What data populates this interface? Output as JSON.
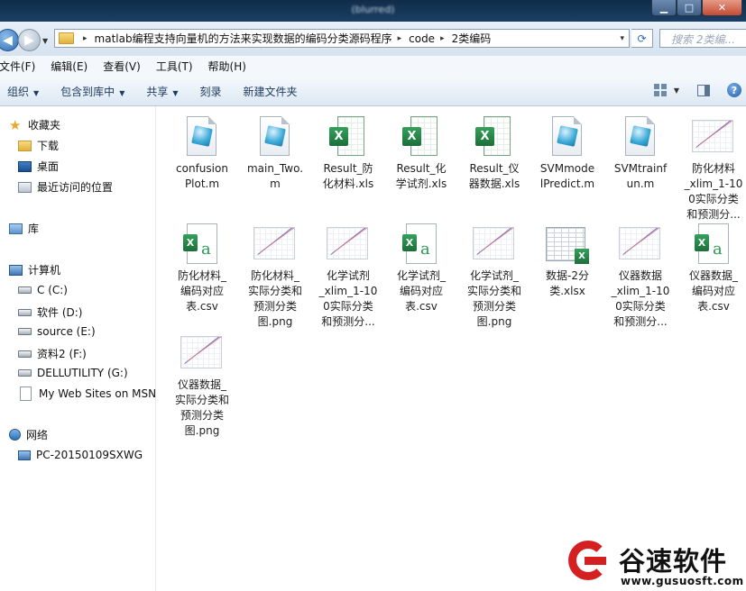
{
  "window": {
    "title": "(blurred)",
    "controls": {
      "minimize": "▁",
      "maximize": "□",
      "close": "✕"
    }
  },
  "address": {
    "back_icon": "back-arrow-icon",
    "forward_icon": "forward-arrow-icon",
    "breadcrumb": [
      "matlab编程支持向量机的方法来实现数据的编码分类源码程序",
      "code",
      "2类编码"
    ],
    "sep": "▸",
    "dropdown": "▾",
    "refresh": "⟳",
    "search_placeholder": "搜索 2类编...",
    "search_icon": "🔍"
  },
  "menu": [
    "文件(F)",
    "编辑(E)",
    "查看(V)",
    "工具(T)",
    "帮助(H)"
  ],
  "toolbar": {
    "organize": "组织",
    "include": "包含到库中",
    "share": "共享",
    "burn": "刻录",
    "new_folder": "新建文件夹",
    "arrow": "▼"
  },
  "nav": {
    "favorites": "收藏夹",
    "downloads": "下载",
    "desktop": "桌面",
    "recent": "最近访问的位置",
    "library": "库",
    "computer": "计算机",
    "drives": [
      "C (C:)",
      "软件 (D:)",
      "source (E:)",
      "资料2 (F:)",
      "DELLUTILITY (G:)",
      "My Web Sites on MSN"
    ],
    "network": "网络",
    "pc": "PC-20150109SXWG"
  },
  "files": [
    {
      "name": "confusionPlot.m",
      "lines": [
        "confusion",
        "Plot.m"
      ],
      "kind": "m"
    },
    {
      "name": "main_Two.m",
      "lines": [
        "main_Two.",
        "m"
      ],
      "kind": "m"
    },
    {
      "name": "Result_防化材料.xls",
      "lines": [
        "Result_防",
        "化材料.xls"
      ],
      "kind": "xls"
    },
    {
      "name": "Result_化学试剂.xls",
      "lines": [
        "Result_化",
        "学试剂.xls"
      ],
      "kind": "xls"
    },
    {
      "name": "Result_仪器数据.xls",
      "lines": [
        "Result_仪",
        "器数据.xls"
      ],
      "kind": "xls"
    },
    {
      "name": "SVMmodelPredict.m",
      "lines": [
        "SVMmode",
        "lPredict.m"
      ],
      "kind": "m"
    },
    {
      "name": "SVMtrainfun.m",
      "lines": [
        "SVMtrainf",
        "un.m"
      ],
      "kind": "m"
    },
    {
      "name": "防化材料_xlim_1-100实际分类和预测分...",
      "lines": [
        "防化材料",
        "_xlim_1-10",
        "0实际分类",
        "和预测分..."
      ],
      "kind": "png"
    },
    {
      "name": "防化材料_编码对应表.csv",
      "lines": [
        "防化材料_",
        "编码对应",
        "表.csv"
      ],
      "kind": "csv"
    },
    {
      "name": "防化材料_实际分类和预测分类图.png",
      "lines": [
        "防化材料_",
        "实际分类和",
        "预测分类",
        "图.png"
      ],
      "kind": "png"
    },
    {
      "name": "化学试剂_xlim_1-100实际分类和预测分...",
      "lines": [
        "化学试剂",
        "_xlim_1-10",
        "0实际分类",
        "和预测分..."
      ],
      "kind": "png"
    },
    {
      "name": "化学试剂_编码对应表.csv",
      "lines": [
        "化学试剂_",
        "编码对应",
        "表.csv"
      ],
      "kind": "csv"
    },
    {
      "name": "化学试剂_实际分类和预测分类图.png",
      "lines": [
        "化学试剂_",
        "实际分类和",
        "预测分类",
        "图.png"
      ],
      "kind": "png"
    },
    {
      "name": "数据-2分类.xlsx",
      "lines": [
        "数据-2分",
        "类.xlsx"
      ],
      "kind": "xlsx"
    },
    {
      "name": "仪器数据_xlim_1-100实际分类和预测分...",
      "lines": [
        "仪器数据",
        "_xlim_1-10",
        "0实际分类",
        "和预测分..."
      ],
      "kind": "png"
    },
    {
      "name": "仪器数据_编码对应表.csv",
      "lines": [
        "仪器数据_",
        "编码对应",
        "表.csv"
      ],
      "kind": "csv"
    },
    {
      "name": "仪器数据_实际分类和预测分类图.png",
      "lines": [
        "仪器数据_",
        "实际分类和",
        "预测分类",
        "图.png"
      ],
      "kind": "png"
    }
  ],
  "watermark": {
    "brand": "谷速软件",
    "url": "www.gusuosft.com"
  },
  "colors": {
    "titlebar": "#0f2d4a",
    "toolbar_text": "#1e3a5c",
    "excel_green": "#1d6e3a",
    "watermark_red": "#d42020"
  }
}
